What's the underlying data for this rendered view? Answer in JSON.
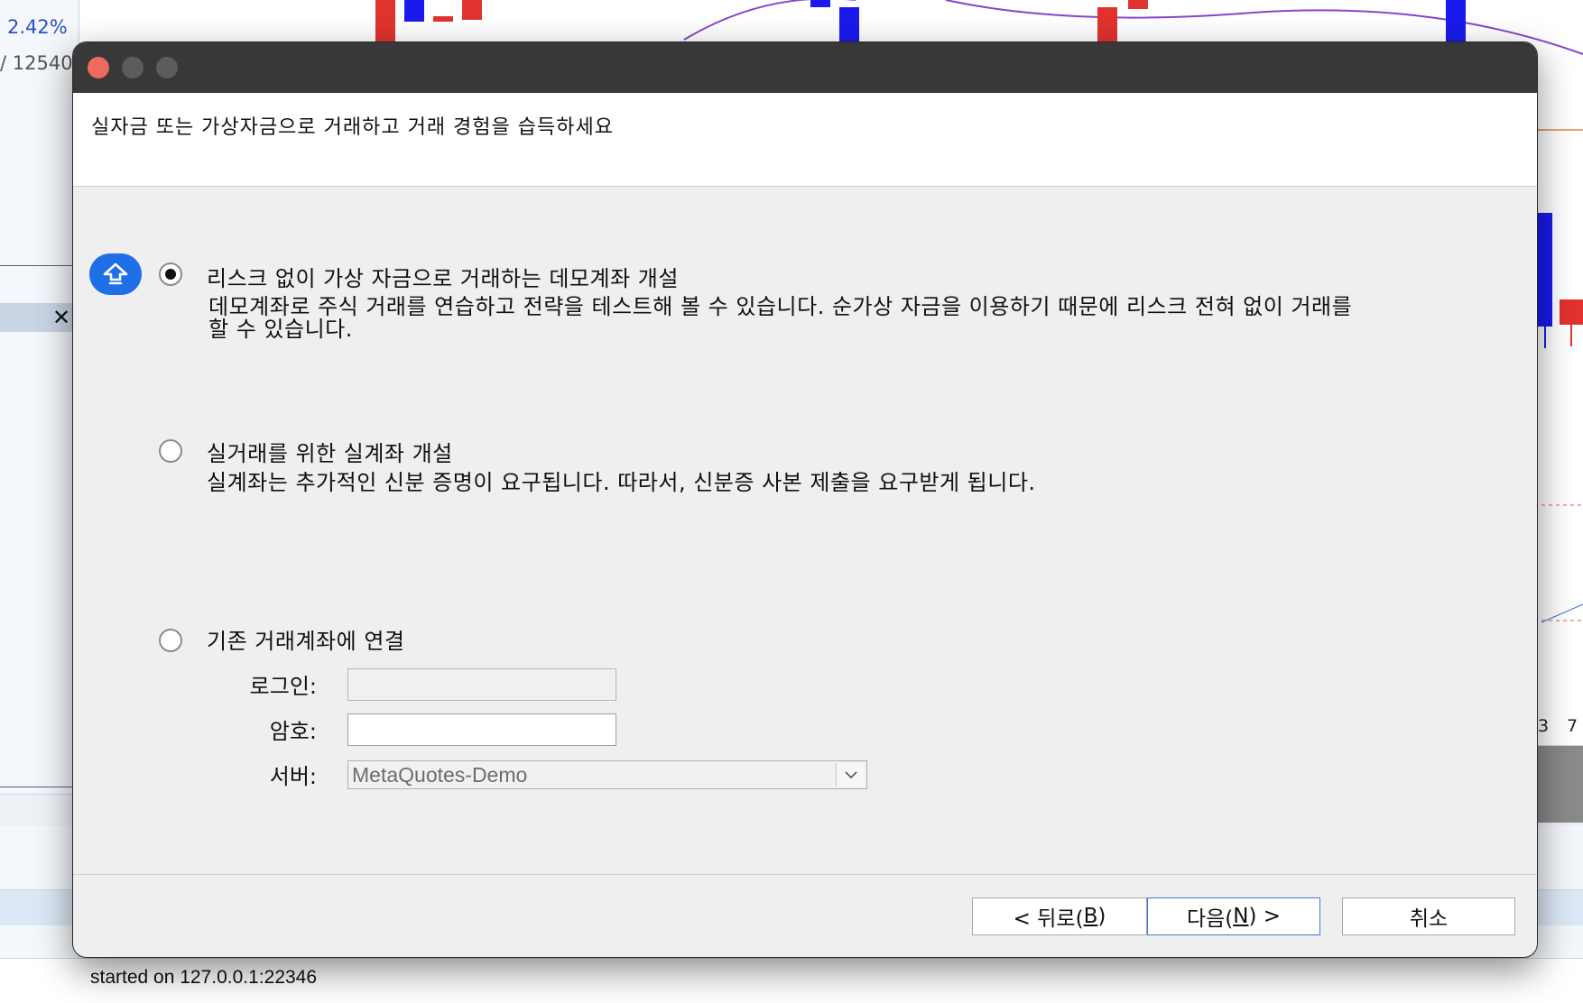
{
  "background": {
    "left_values": [
      "2.42%",
      "/ 12540"
    ],
    "close_icon": "close-x-icon",
    "status_text": "started on 127.0.0.1:22346",
    "axis_labels": [
      "3",
      "7"
    ]
  },
  "dialog": {
    "window_controls": [
      "close-icon",
      "minimize-icon",
      "maximize-icon"
    ],
    "header_text": "실자금 또는 가상자금으로 거래하고 거래 경험을 습득하세요",
    "accent_color": "#1f6fe6",
    "options": [
      {
        "title": "리스크 없이 가상 자금으로 거래하는 데모계좌 개설",
        "description": "데모계좌로 주식 거래를 연습하고 전략을 테스트해 볼 수 있습니다. 순가상 자금을 이용하기 때문에 리스크 전혀 없이 거래를",
        "description_2": "할 수 있습니다.",
        "selected": true,
        "icon": "demo-account-icon"
      },
      {
        "title": "실거래를 위한 실계좌 개설",
        "description": "실계좌는 추가적인 신분 증명이 요구됩니다. 따라서, 신분증 사본 제출을 요구받게 됩니다.",
        "selected": false
      },
      {
        "title": "기존 거래계좌에 연결",
        "selected": false
      }
    ],
    "fields": {
      "login_label": "로그인:",
      "login_value": "",
      "password_label": "암호:",
      "password_value": "",
      "server_label": "서버:",
      "server_value": "MetaQuotes-Demo",
      "server_dropdown_icon": "chevron-down-icon"
    },
    "buttons": {
      "back_prefix": "< 뒤로(",
      "back_key": "B",
      "back_suffix": ")",
      "next_prefix": "다음(",
      "next_key": "N",
      "next_suffix": ") >",
      "cancel": "취소"
    }
  }
}
